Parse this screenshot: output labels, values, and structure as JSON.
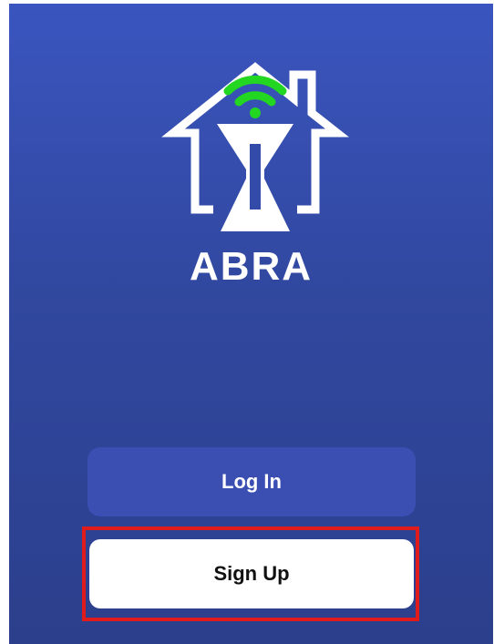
{
  "app": {
    "brand_name": "ABRA",
    "logo_icon": "house-wifi-hourglass-icon"
  },
  "actions": {
    "login_label": "Log In",
    "signup_label": "Sign Up"
  },
  "colors": {
    "background_top": "#3a55bf",
    "background_bottom": "#2b3f8c",
    "login_button": "#3b4fb3",
    "signup_button": "#ffffff",
    "wifi_accent": "#22d622",
    "highlight_outline": "#e01b1b"
  }
}
